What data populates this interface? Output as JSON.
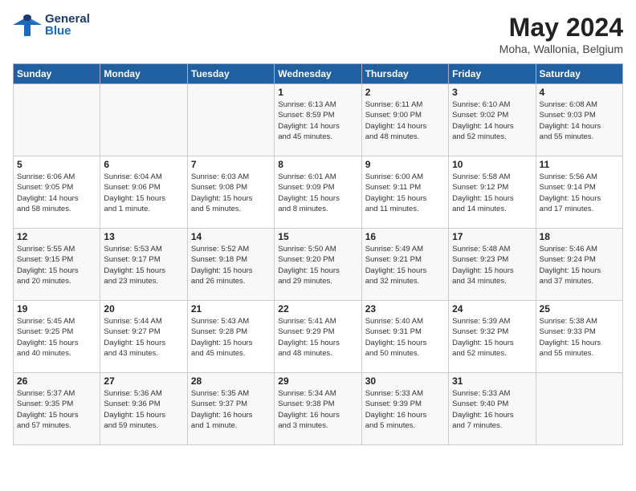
{
  "header": {
    "logo_general": "General",
    "logo_blue": "Blue",
    "month_year": "May 2024",
    "location": "Moha, Wallonia, Belgium"
  },
  "weekdays": [
    "Sunday",
    "Monday",
    "Tuesday",
    "Wednesday",
    "Thursday",
    "Friday",
    "Saturday"
  ],
  "weeks": [
    [
      {
        "day": "",
        "info": ""
      },
      {
        "day": "",
        "info": ""
      },
      {
        "day": "",
        "info": ""
      },
      {
        "day": "1",
        "info": "Sunrise: 6:13 AM\nSunset: 8:59 PM\nDaylight: 14 hours\nand 45 minutes."
      },
      {
        "day": "2",
        "info": "Sunrise: 6:11 AM\nSunset: 9:00 PM\nDaylight: 14 hours\nand 48 minutes."
      },
      {
        "day": "3",
        "info": "Sunrise: 6:10 AM\nSunset: 9:02 PM\nDaylight: 14 hours\nand 52 minutes."
      },
      {
        "day": "4",
        "info": "Sunrise: 6:08 AM\nSunset: 9:03 PM\nDaylight: 14 hours\nand 55 minutes."
      }
    ],
    [
      {
        "day": "5",
        "info": "Sunrise: 6:06 AM\nSunset: 9:05 PM\nDaylight: 14 hours\nand 58 minutes."
      },
      {
        "day": "6",
        "info": "Sunrise: 6:04 AM\nSunset: 9:06 PM\nDaylight: 15 hours\nand 1 minute."
      },
      {
        "day": "7",
        "info": "Sunrise: 6:03 AM\nSunset: 9:08 PM\nDaylight: 15 hours\nand 5 minutes."
      },
      {
        "day": "8",
        "info": "Sunrise: 6:01 AM\nSunset: 9:09 PM\nDaylight: 15 hours\nand 8 minutes."
      },
      {
        "day": "9",
        "info": "Sunrise: 6:00 AM\nSunset: 9:11 PM\nDaylight: 15 hours\nand 11 minutes."
      },
      {
        "day": "10",
        "info": "Sunrise: 5:58 AM\nSunset: 9:12 PM\nDaylight: 15 hours\nand 14 minutes."
      },
      {
        "day": "11",
        "info": "Sunrise: 5:56 AM\nSunset: 9:14 PM\nDaylight: 15 hours\nand 17 minutes."
      }
    ],
    [
      {
        "day": "12",
        "info": "Sunrise: 5:55 AM\nSunset: 9:15 PM\nDaylight: 15 hours\nand 20 minutes."
      },
      {
        "day": "13",
        "info": "Sunrise: 5:53 AM\nSunset: 9:17 PM\nDaylight: 15 hours\nand 23 minutes."
      },
      {
        "day": "14",
        "info": "Sunrise: 5:52 AM\nSunset: 9:18 PM\nDaylight: 15 hours\nand 26 minutes."
      },
      {
        "day": "15",
        "info": "Sunrise: 5:50 AM\nSunset: 9:20 PM\nDaylight: 15 hours\nand 29 minutes."
      },
      {
        "day": "16",
        "info": "Sunrise: 5:49 AM\nSunset: 9:21 PM\nDaylight: 15 hours\nand 32 minutes."
      },
      {
        "day": "17",
        "info": "Sunrise: 5:48 AM\nSunset: 9:23 PM\nDaylight: 15 hours\nand 34 minutes."
      },
      {
        "day": "18",
        "info": "Sunrise: 5:46 AM\nSunset: 9:24 PM\nDaylight: 15 hours\nand 37 minutes."
      }
    ],
    [
      {
        "day": "19",
        "info": "Sunrise: 5:45 AM\nSunset: 9:25 PM\nDaylight: 15 hours\nand 40 minutes."
      },
      {
        "day": "20",
        "info": "Sunrise: 5:44 AM\nSunset: 9:27 PM\nDaylight: 15 hours\nand 43 minutes."
      },
      {
        "day": "21",
        "info": "Sunrise: 5:43 AM\nSunset: 9:28 PM\nDaylight: 15 hours\nand 45 minutes."
      },
      {
        "day": "22",
        "info": "Sunrise: 5:41 AM\nSunset: 9:29 PM\nDaylight: 15 hours\nand 48 minutes."
      },
      {
        "day": "23",
        "info": "Sunrise: 5:40 AM\nSunset: 9:31 PM\nDaylight: 15 hours\nand 50 minutes."
      },
      {
        "day": "24",
        "info": "Sunrise: 5:39 AM\nSunset: 9:32 PM\nDaylight: 15 hours\nand 52 minutes."
      },
      {
        "day": "25",
        "info": "Sunrise: 5:38 AM\nSunset: 9:33 PM\nDaylight: 15 hours\nand 55 minutes."
      }
    ],
    [
      {
        "day": "26",
        "info": "Sunrise: 5:37 AM\nSunset: 9:35 PM\nDaylight: 15 hours\nand 57 minutes."
      },
      {
        "day": "27",
        "info": "Sunrise: 5:36 AM\nSunset: 9:36 PM\nDaylight: 15 hours\nand 59 minutes."
      },
      {
        "day": "28",
        "info": "Sunrise: 5:35 AM\nSunset: 9:37 PM\nDaylight: 16 hours\nand 1 minute."
      },
      {
        "day": "29",
        "info": "Sunrise: 5:34 AM\nSunset: 9:38 PM\nDaylight: 16 hours\nand 3 minutes."
      },
      {
        "day": "30",
        "info": "Sunrise: 5:33 AM\nSunset: 9:39 PM\nDaylight: 16 hours\nand 5 minutes."
      },
      {
        "day": "31",
        "info": "Sunrise: 5:33 AM\nSunset: 9:40 PM\nDaylight: 16 hours\nand 7 minutes."
      },
      {
        "day": "",
        "info": ""
      }
    ]
  ]
}
